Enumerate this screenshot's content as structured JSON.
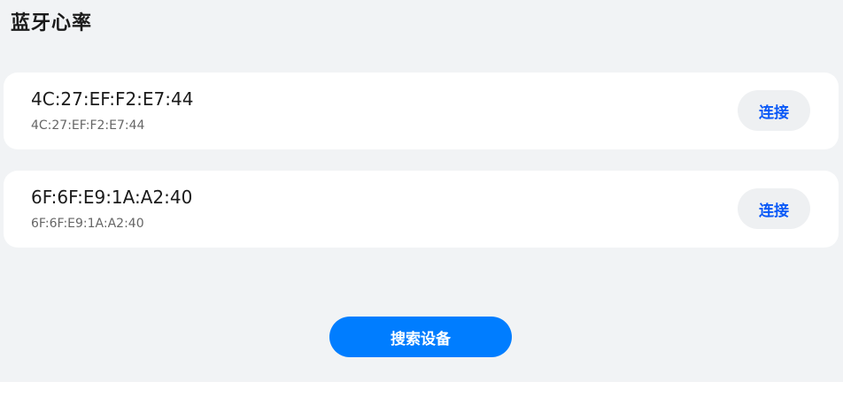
{
  "header": {
    "title": "蓝牙心率"
  },
  "devices": [
    {
      "name": "4C:27:EF:F2:E7:44",
      "address": "4C:27:EF:F2:E7:44",
      "connect_label": "连接"
    },
    {
      "name": "6F:6F:E9:1A:A2:40",
      "address": "6F:6F:E9:1A:A2:40",
      "connect_label": "连接"
    }
  ],
  "actions": {
    "search_label": "搜索设备"
  },
  "colors": {
    "accent": "#007dff",
    "link": "#0a59f7",
    "background": "#f1f3f5"
  }
}
